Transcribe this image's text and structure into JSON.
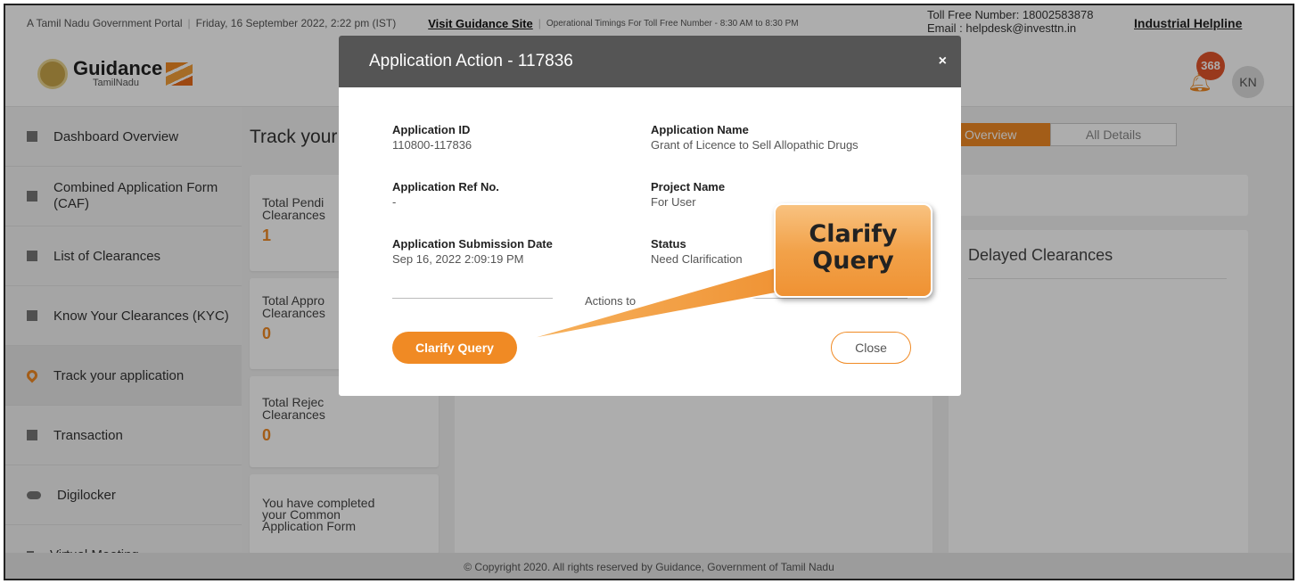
{
  "topbar": {
    "portal": "A Tamil Nadu Government Portal",
    "datetime": "Friday, 16 September 2022, 2:22 pm (IST)",
    "visit_link": "Visit Guidance Site",
    "timings": "Operational Timings For Toll Free Number - 8:30 AM to 8:30 PM",
    "toll_free": "Toll Free Number: 18002583878",
    "email": "Email : helpdesk@investtn.in",
    "industrial_helpline": "Industrial Helpline"
  },
  "header": {
    "logo_name": "Guidance",
    "logo_sub": "TamilNadu",
    "notification_count": "368",
    "avatar_initials": "KN"
  },
  "sidebar": {
    "items": [
      {
        "label": "Dashboard Overview",
        "icon": "dashboard-icon"
      },
      {
        "label": "Combined Application Form (CAF)",
        "icon": "document-icon"
      },
      {
        "label": "List of Clearances",
        "icon": "list-icon"
      },
      {
        "label": "Know Your Clearances (KYC)",
        "icon": "kyc-icon"
      },
      {
        "label": "Track your application",
        "icon": "location-pin-icon"
      },
      {
        "label": "Transaction",
        "icon": "transaction-icon"
      },
      {
        "label": "Digilocker",
        "icon": "cloud-icon"
      },
      {
        "label": "Virtual Meeting",
        "icon": "meeting-icon"
      }
    ]
  },
  "main": {
    "title": "Track your",
    "stats": [
      {
        "label": "Total Pendi Clearances",
        "value": "1"
      },
      {
        "label": "Total Appro Clearances",
        "value": "0"
      },
      {
        "label": "Total Rejec Clearances",
        "value": "0"
      }
    ],
    "caf_message": "You have completed your Common Application Form"
  },
  "right": {
    "tab_overview": "Overview",
    "tab_all_details": "All Details",
    "delayed_title": "Delayed Clearances"
  },
  "modal": {
    "title": "Application Action - 117836",
    "close_glyph": "×",
    "fields": {
      "app_id_label": "Application ID",
      "app_id": "110800-117836",
      "app_name_label": "Application Name",
      "app_name": "Grant of Licence to Sell Allopathic Drugs",
      "ref_label": "Application Ref No.",
      "ref": "-",
      "project_label": "Project Name",
      "project": "For User",
      "date_label": "Application Submission Date",
      "date": "Sep 16, 2022 2:09:19 PM",
      "status_label": "Status",
      "status": "Need Clarification"
    },
    "actions_text": "Actions to",
    "clarify_button": "Clarify Query",
    "close_button": "Close"
  },
  "callout": {
    "line1": "Clarify",
    "line2": "Query"
  },
  "footer": {
    "copyright": "©   Copyright 2020. All rights reserved by Guidance, Government of Tamil Nadu"
  },
  "colors": {
    "accent": "#f08a24",
    "modal_header": "#555555"
  }
}
